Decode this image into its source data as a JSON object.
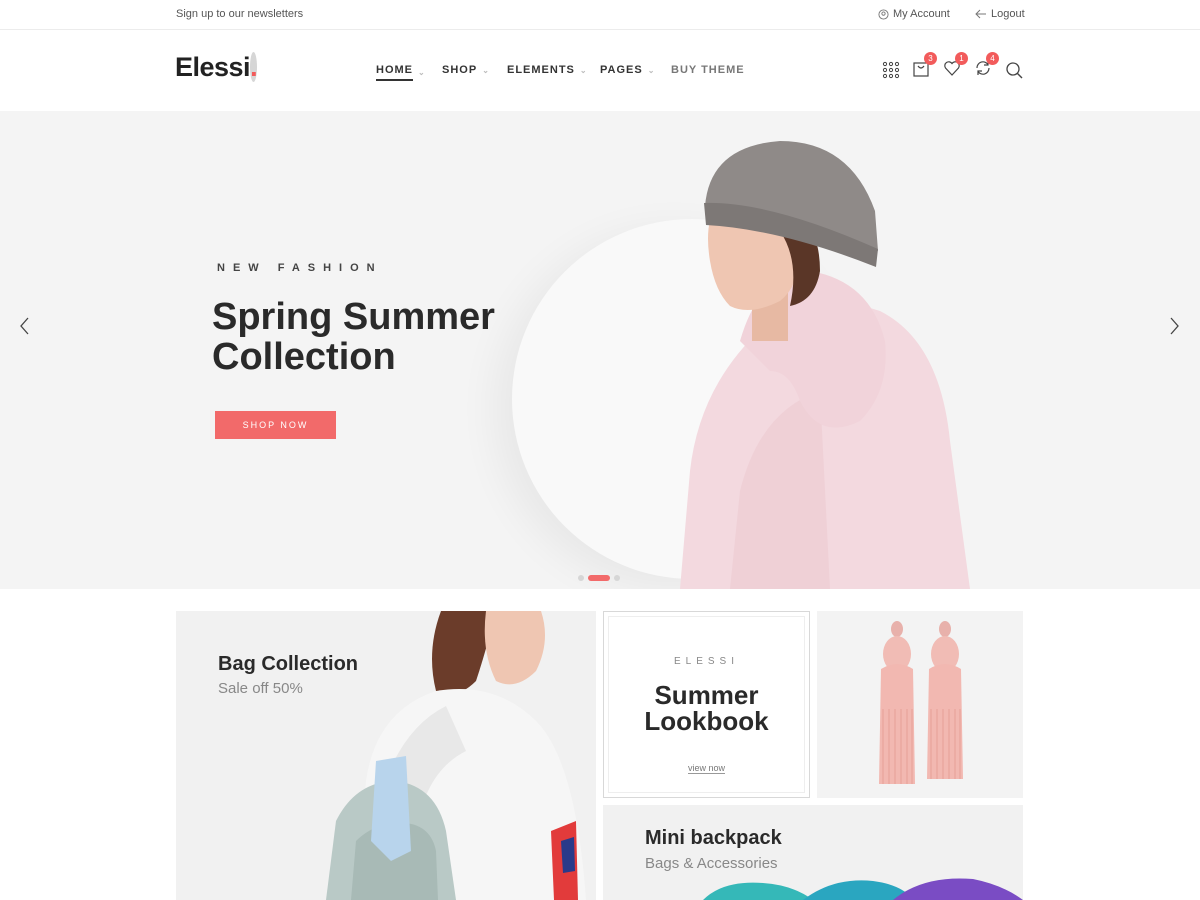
{
  "topbar": {
    "newsletter": "Sign up to our newsletters",
    "account": "My Account",
    "logout": "Logout"
  },
  "header": {
    "logo": "Elessi",
    "logo_dot": ".",
    "nav": [
      {
        "label": "HOME",
        "has_dropdown": true,
        "active": true
      },
      {
        "label": "SHOP",
        "has_dropdown": true
      },
      {
        "label": "ELEMENTS",
        "has_dropdown": true
      },
      {
        "label": "PAGES",
        "has_dropdown": true
      },
      {
        "label": "BUY THEME",
        "has_dropdown": false
      }
    ],
    "icons": [
      {
        "name": "grid-icon"
      },
      {
        "name": "cart-icon",
        "badge": "3"
      },
      {
        "name": "heart-icon",
        "badge": "1"
      },
      {
        "name": "compare-icon",
        "badge": "4"
      },
      {
        "name": "search-icon"
      }
    ]
  },
  "hero": {
    "eyebrow": "NEW FASHION",
    "title": "Spring Summer Collection",
    "button": "SHOP NOW",
    "slides": 3,
    "active_slide": 2
  },
  "banners": {
    "bag": {
      "title": "Bag Collection",
      "subtitle": "Sale off 50%"
    },
    "lookbook": {
      "eyebrow": "ELESSI",
      "title": "Summer Lookbook",
      "link": "view now"
    },
    "backpack": {
      "title": "Mini backpack",
      "subtitle": "Bags & Accessories"
    }
  },
  "colors": {
    "accent": "#f26a6a",
    "text": "#2a2a2a",
    "muted": "#888888"
  }
}
